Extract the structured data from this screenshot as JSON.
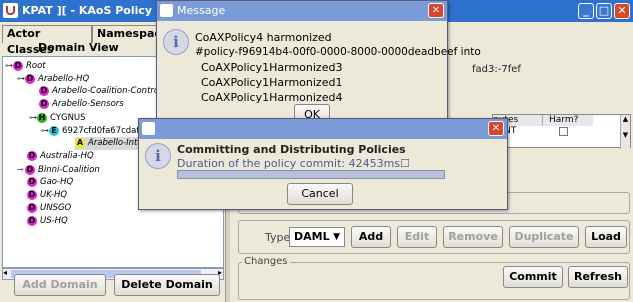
{
  "window": {
    "title": "KPAT ][ - KAoS Policy Administrat",
    "icon": "java-icon"
  },
  "left": {
    "tabs": [
      "Actor Classes",
      "Namespaces"
    ],
    "subtab": "Domain View",
    "tree": [
      {
        "label": "Root",
        "badge": "D",
        "italic": true
      },
      {
        "label": "Arabello-HQ",
        "badge": "D",
        "italic": true
      },
      {
        "label": "Arabello-Coalition-Contro",
        "badge": "D",
        "italic": true
      },
      {
        "label": "Arabello-Sensors",
        "badge": "D",
        "italic": true
      },
      {
        "label": "CYGNUS",
        "badge": "H",
        "italic": false
      },
      {
        "label": "6927cfd0fa67cdaf",
        "badge": "E",
        "italic": false
      },
      {
        "label": "Arabello-Inter",
        "badge": "A",
        "italic": true
      },
      {
        "label": "Australia-HQ",
        "badge": "D",
        "italic": true
      },
      {
        "label": "Binni-Coalition",
        "badge": "D",
        "italic": true
      },
      {
        "label": "Gao-HQ",
        "badge": "D",
        "italic": true
      },
      {
        "label": "UK-HQ",
        "badge": "D",
        "italic": true
      },
      {
        "label": "UNSGO",
        "badge": "D",
        "italic": true
      },
      {
        "label": "US-HQ",
        "badge": "D",
        "italic": true
      }
    ],
    "add_domain": "Add Domain",
    "delete_domain": "Delete Domain"
  },
  "right": {
    "id_fragment": "fad3:-7fef",
    "table_headers": [
      "putes",
      "Harm?"
    ],
    "table_cell": "TENT",
    "type_label": "Type",
    "type_value": "DAML",
    "buttons": [
      "Add",
      "Edit",
      "Remove",
      "Duplicate",
      "Load"
    ],
    "changes_label": "Changes",
    "commit": "Commit",
    "refresh": "Refresh"
  },
  "message_dialog": {
    "title": "Message",
    "lines": [
      "CoAXPolicy4 harmonized",
      "#policy-f96914b4-00f0-0000-8000-0000deadbeef into",
      "CoAXPolicy1Harmonized3",
      "CoAXPolicy1Harmonized1",
      "CoAXPolicy1Harmonized4"
    ],
    "ok": "OK"
  },
  "progress_dialog": {
    "title": "",
    "heading": "Committing and Distributing Policies",
    "detail": "Duration of the policy commit: 42453ms☐",
    "progress": 1.0,
    "cancel": "Cancel"
  },
  "colors": {
    "titlebar": "#2f71cf",
    "dialog_titlebar": "#7a9ad8",
    "progress_fill": "#b8c0dc"
  }
}
